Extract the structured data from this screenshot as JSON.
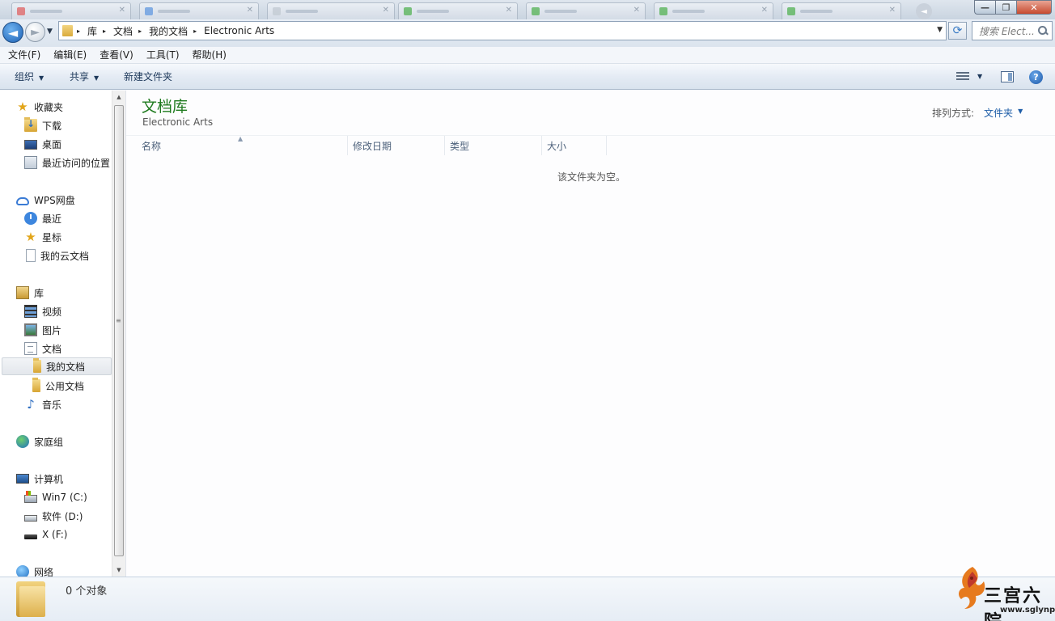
{
  "window": {
    "minimize_glyph": "—",
    "maximize_glyph": "❐",
    "close_glyph": "✕",
    "restore_glyph": "◄"
  },
  "address": {
    "back_glyph": "◄",
    "forward_glyph": "►",
    "history_glyph": "▼",
    "breadcrumb": [
      "库",
      "文档",
      "我的文档",
      "Electronic Arts"
    ],
    "separator": "▸",
    "dropdown_glyph": "▼",
    "refresh_glyph": "⟳",
    "search_placeholder": "搜索 Elect..."
  },
  "menubar": [
    "文件(F)",
    "编辑(E)",
    "查看(V)",
    "工具(T)",
    "帮助(H)"
  ],
  "toolbar": {
    "organize": "组织",
    "share": "共享",
    "new_folder": "新建文件夹",
    "caret": "▼",
    "help_glyph": "?"
  },
  "nav": {
    "favorites": {
      "title": "收藏夹",
      "items": [
        "下载",
        "桌面",
        "最近访问的位置"
      ]
    },
    "wps": {
      "title": "WPS网盘",
      "items": [
        "最近",
        "星标",
        "我的云文档"
      ]
    },
    "libraries": {
      "title": "库",
      "items": [
        "视频",
        "图片",
        "文档",
        "音乐"
      ],
      "documents_children": [
        "我的文档",
        "公用文档"
      ],
      "selected": "我的文档"
    },
    "homegroup": "家庭组",
    "computer": {
      "title": "计算机",
      "drives": [
        "Win7 (C:)",
        "软件 (D:)",
        "X (F:)"
      ]
    },
    "network": "网络",
    "scroll_up": "▲",
    "scroll_down": "▼",
    "scroll_grip": "≡"
  },
  "content": {
    "library_title": "文档库",
    "folder_name": "Electronic Arts",
    "arrange_label": "排列方式:",
    "arrange_value": "文件夹",
    "arrange_caret": "▼",
    "columns": [
      "名称",
      "修改日期",
      "类型",
      "大小"
    ],
    "sort_indicator": "▲",
    "empty_message": "该文件夹为空。"
  },
  "details": {
    "object_count": "0 个对象"
  },
  "watermark": {
    "name": "三宫六院",
    "url": "www.sglynp.com"
  }
}
